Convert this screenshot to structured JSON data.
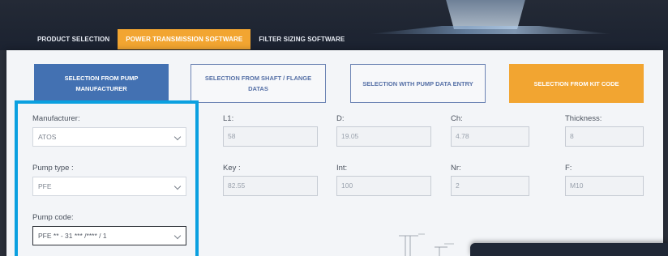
{
  "tabs": [
    {
      "label": "PRODUCT SELECTION",
      "active": false
    },
    {
      "label": "POWER TRANSMISSION SOFTWARE",
      "active": true
    },
    {
      "label": "FILTER SIZING SOFTWARE",
      "active": false
    }
  ],
  "modes": [
    {
      "label": "SELECTION FROM PUMP MANUFACTURER",
      "style": "primary"
    },
    {
      "label": "SELECTION FROM SHAFT / FLANGE DATAS",
      "style": "outline"
    },
    {
      "label": "SELECTION WITH PUMP DATA ENTRY",
      "style": "outline"
    },
    {
      "label": "SELECTION FROM KIT CODE",
      "style": "accent"
    }
  ],
  "selects": {
    "manufacturer": {
      "label": "Manufacturer:",
      "value": "ATOS"
    },
    "pump_type": {
      "label": "Pump type :",
      "value": "PFE"
    },
    "pump_code": {
      "label": "Pump code:",
      "value": "PFE ** - 31 *** /**** / 1"
    }
  },
  "fields": {
    "l1": {
      "label": "L1:",
      "value": "58"
    },
    "d": {
      "label": "D:",
      "value": "19.05"
    },
    "ch": {
      "label": "Ch:",
      "value": "4.78"
    },
    "thickness": {
      "label": "Thickness:",
      "value": "8"
    },
    "key": {
      "label": "Key :",
      "value": "82.55"
    },
    "int": {
      "label": "Int:",
      "value": "100"
    },
    "nr": {
      "label": "Nr:",
      "value": "2"
    },
    "f": {
      "label": "F:",
      "value": "M10"
    }
  },
  "colors": {
    "accent": "#f2a531",
    "primary": "#4371b2",
    "highlight": "#0aa0e0",
    "banner": "#1f2533"
  }
}
